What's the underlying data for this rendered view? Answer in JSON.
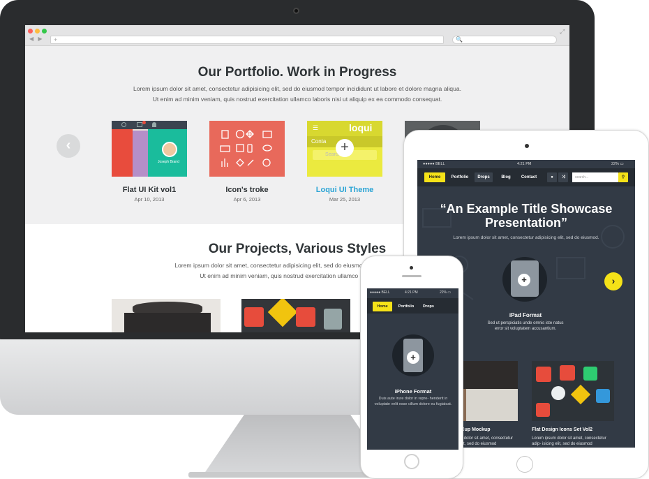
{
  "browser": {
    "nav_arrows": "◀ ▶",
    "url_placeholder": "+",
    "search_icon": "🔍",
    "expand_icon": "⤢"
  },
  "portfolio": {
    "title": "Our Portfolio. Work in Progress",
    "text_line1": "Lorem ipsum dolor sit amet, consectetur adipisicing elit, sed do eiusmod tempor incididunt ut labore et dolore magna aliqua.",
    "text_line2": "Ut enim ad minim veniam, quis nostrud exercitation ullamco laboris nisi ut aliquip ex ea commodo consequat.",
    "prev_icon": "‹",
    "items": [
      {
        "title": "Flat UI Kit vol1",
        "date": "Apr 10, 2013"
      },
      {
        "title": "Icon's troke",
        "date": "Apr 6, 2013"
      },
      {
        "title": "Loqui UI Theme",
        "date": "Mar 25, 2013"
      }
    ],
    "thumb1_name": "Joseph Brand",
    "thumb3_brand": "loqui",
    "thumb3_tab": "Conta",
    "thumb3_search": "Search",
    "plus": "+",
    "accent_color": "#2aa4d5"
  },
  "projects": {
    "title": "Our Projects, Various Styles",
    "text_line1": "Lorem ipsum dolor sit amet, consectetur adipisicing elit, sed do eiusmod tempor incididunt ut",
    "text_line2": "Ut enim ad minim veniam, quis nostrud exercitation ullamco laboris nisi ut"
  },
  "ipad": {
    "status_carrier": "●●●●● BELL",
    "status_time": "4:21 PM",
    "status_battery": "22% ▭",
    "nav": [
      "Home",
      "Portfolio",
      "Drops",
      "Blog",
      "Contact"
    ],
    "search_placeholder": "search...",
    "headline": "“An Example Title Showcase Presentation”",
    "sub": "Lorem ipsum dolor sit amet, consectetur adipisicing elit, sed do eiusmod.",
    "plus": "+",
    "next_icon": "›",
    "format_title": "iPad Format",
    "format_text": "Sed ut perspiciatis unde omnis iste natus error sit voluptatem accusantium.",
    "cap1": "ot Cup Mockup",
    "cap1_text": "m dolor sit amet, consectetur elit, sed do eiusmod",
    "cap2": "Flat Design Icons Set Vol2",
    "cap2_text": "Lorem ipsum dolor sit amet, consectetur adip- isicing elit, sed do eiusmod"
  },
  "iphone": {
    "status_carrier": "●●●●● BELL",
    "status_time": "4:21 PM",
    "status_battery": "22% ▭",
    "nav": [
      "Home",
      "Portfolio",
      "Drops"
    ],
    "plus": "+",
    "format_title": "iPhone Format",
    "format_text": "Duis aute irure dolor in repre- henderit in voluptate velit esse cillum dolore eu fugiatcat."
  },
  "colors": {
    "accent_yellow": "#f5e218",
    "dark_screen": "#323a45",
    "coral": "#e8695b"
  }
}
